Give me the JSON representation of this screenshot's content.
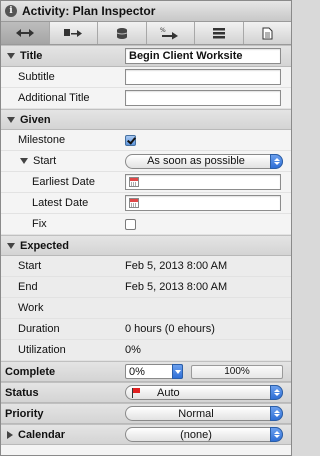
{
  "window": {
    "title": "Activity: Plan Inspector"
  },
  "toolbar": {
    "tools": [
      "dependency-tool-icon",
      "chart-tool-icon",
      "database-tool-icon",
      "activity-tool-icon",
      "list-tool-icon",
      "note-tool-icon"
    ]
  },
  "rows": {
    "title_header": "Title",
    "title_value": "Begin Client Worksite",
    "subtitle": "Subtitle",
    "subtitle_value": "",
    "additional_title": "Additional Title",
    "additional_title_value": "",
    "given_header": "Given",
    "milestone": "Milestone",
    "start": "Start",
    "start_value": "As soon as possible",
    "earliest_date": "Earliest Date",
    "earliest_date_value": "",
    "latest_date": "Latest Date",
    "latest_date_value": "",
    "fix": "Fix",
    "expected_header": "Expected",
    "exp_start": "Start",
    "exp_start_value": "Feb 5, 2013 8:00 AM",
    "exp_end": "End",
    "exp_end_value": "Feb 5, 2013 8:00 AM",
    "work": "Work",
    "work_value": "",
    "duration": "Duration",
    "duration_value": "0 hours  (0 ehours)",
    "utilization": "Utilization",
    "utilization_value": "0%",
    "complete": "Complete",
    "complete_value": "0%",
    "complete_progress": "100%",
    "status": "Status",
    "status_value": "Auto",
    "priority": "Priority",
    "priority_value": "Normal",
    "calendar": "Calendar",
    "calendar_value": "(none)"
  },
  "state": {
    "milestone_checked": true,
    "fix_checked": false
  },
  "colors": {
    "accent": "#2f6fd6",
    "flag": "#e02020"
  }
}
